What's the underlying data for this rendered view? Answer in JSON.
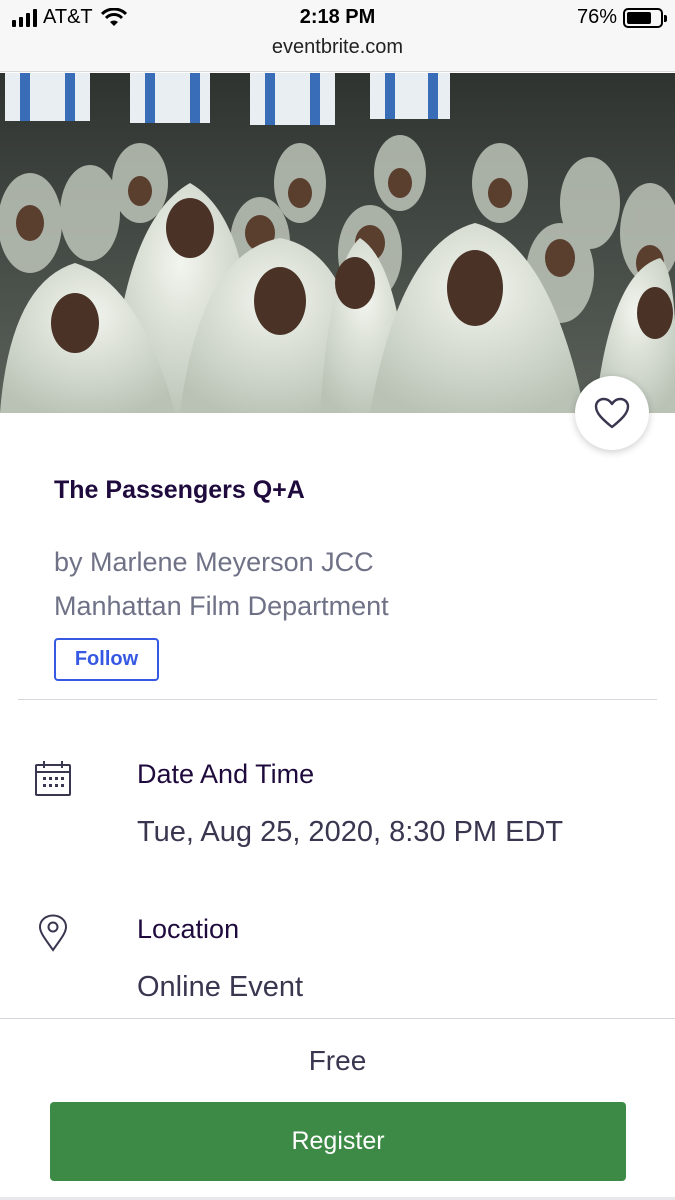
{
  "status_bar": {
    "carrier": "AT&T",
    "time": "2:18 PM",
    "url": "eventbrite.com",
    "battery_percent": "76%",
    "battery_level": 0.76
  },
  "event": {
    "title": "The Passengers Q+A",
    "organizer_line1": "by Marlene Meyerson JCC",
    "organizer_line2": "Manhattan Film Department",
    "follow_label": "Follow",
    "hero_image": "event photo: rows of people in white shawls with flags above",
    "favorite_icon": "heart-icon"
  },
  "details": {
    "date_label": "Date And Time",
    "date_value": "Tue, Aug 25, 2020, 8:30 PM EDT",
    "date_icon": "calendar-icon",
    "location_label": "Location",
    "location_value": "Online Event",
    "location_icon": "map-pin-icon"
  },
  "checkout": {
    "price": "Free",
    "register_label": "Register"
  },
  "colors": {
    "title": "#1e0a3c",
    "secondary_text": "#6f7287",
    "follow_blue": "#3659e3",
    "register_green": "#3d8a47"
  }
}
